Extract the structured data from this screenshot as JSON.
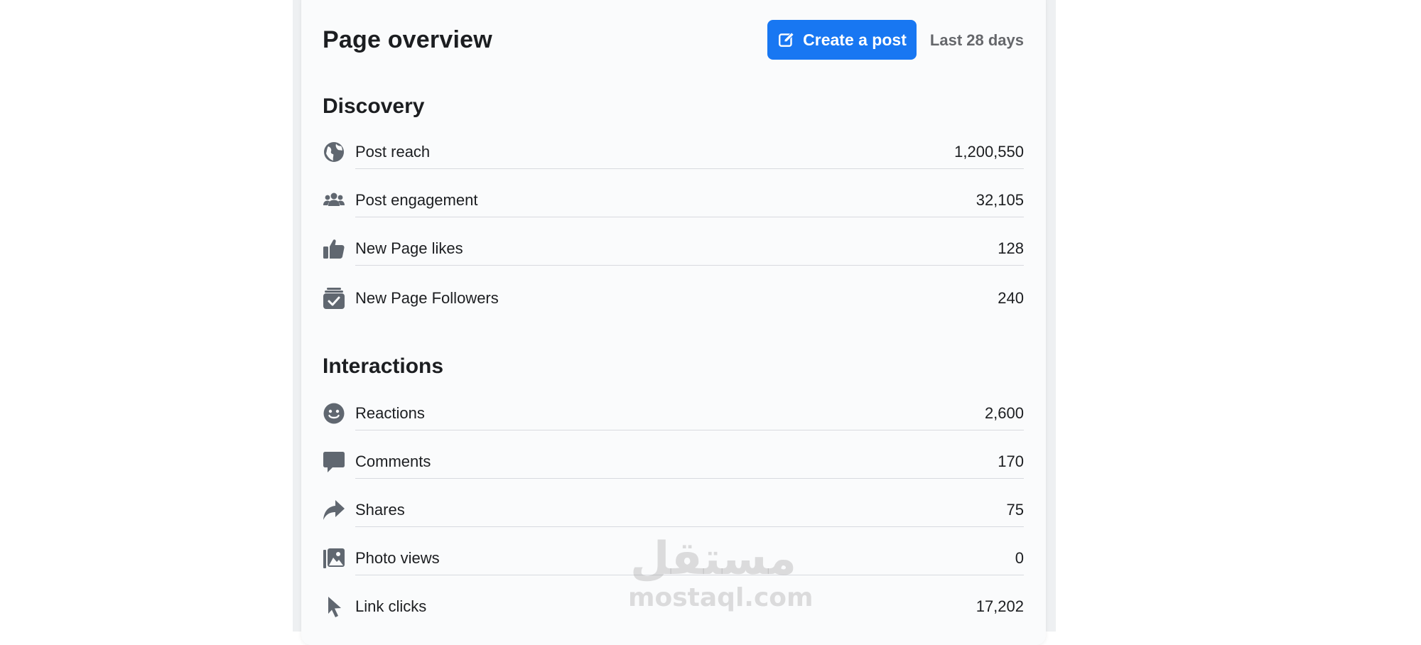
{
  "header": {
    "title": "Page overview",
    "create_post_label": "Create a post",
    "date_range": "Last 28 days"
  },
  "colors": {
    "accent": "#1877f2",
    "icon_gray": "#606770",
    "muted_text": "#65676b"
  },
  "discovery": {
    "title": "Discovery",
    "rows": [
      {
        "label": "Post reach",
        "value": "1,200,550",
        "icon": "globe-icon"
      },
      {
        "label": "Post engagement",
        "value": "32,105",
        "icon": "people-icon"
      },
      {
        "label": "New Page likes",
        "value": "128",
        "icon": "thumbs-up-icon"
      },
      {
        "label": "New Page Followers",
        "value": "240",
        "icon": "follow-check-icon"
      }
    ]
  },
  "interactions": {
    "title": "Interactions",
    "rows": [
      {
        "label": "Reactions",
        "value": "2,600",
        "icon": "smiley-icon"
      },
      {
        "label": "Comments",
        "value": "170",
        "icon": "comment-bubble-icon"
      },
      {
        "label": "Shares",
        "value": "75",
        "icon": "share-arrow-icon"
      },
      {
        "label": "Photo views",
        "value": "0",
        "icon": "photos-icon"
      },
      {
        "label": "Link clicks",
        "value": "17,202",
        "icon": "cursor-icon"
      }
    ]
  },
  "watermark": {
    "logo": "مستقل",
    "domain": "mostaql.com"
  }
}
